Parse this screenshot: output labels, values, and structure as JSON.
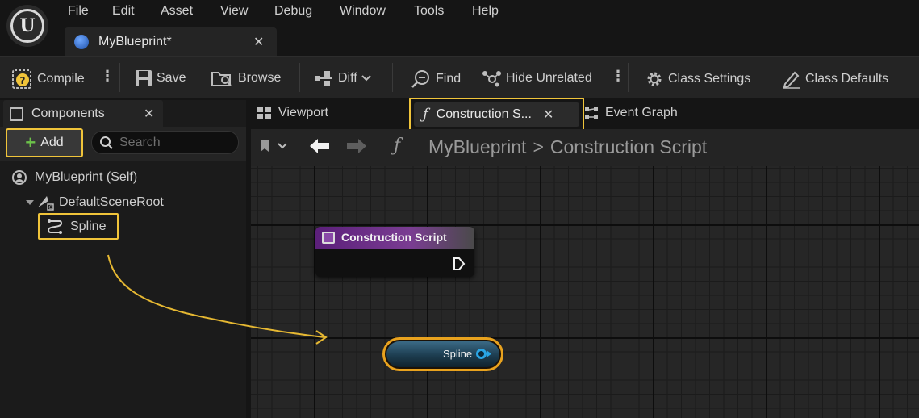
{
  "menu": {
    "items": [
      "File",
      "Edit",
      "Asset",
      "View",
      "Debug",
      "Window",
      "Tools",
      "Help"
    ]
  },
  "document_tab": {
    "label": "MyBlueprint*"
  },
  "toolbar": {
    "compile": "Compile",
    "save": "Save",
    "browse": "Browse",
    "diff": "Diff",
    "find": "Find",
    "hide_unrelated": "Hide Unrelated",
    "class_settings": "Class Settings",
    "class_defaults": "Class Defaults"
  },
  "components_panel": {
    "tab_label": "Components",
    "add_label": "Add",
    "search_placeholder": "Search",
    "tree": {
      "root": "MyBlueprint (Self)",
      "scene_root": "DefaultSceneRoot",
      "child": "Spline"
    }
  },
  "editor_tabs": {
    "viewport": "Viewport",
    "construction": "Construction S...",
    "event_graph": "Event Graph"
  },
  "breadcrumb": {
    "blueprint": "MyBlueprint",
    "separator": ">",
    "graph": "Construction Script"
  },
  "nodes": {
    "construction_script": "Construction Script",
    "spline_getter": "Spline"
  },
  "colors": {
    "highlight": "#f0c43a",
    "construction_header": "#5b1f7a",
    "spline_pin": "#2aa6e6",
    "spline_node_border": "#e8a21e",
    "add_plus": "#6cc24a"
  }
}
